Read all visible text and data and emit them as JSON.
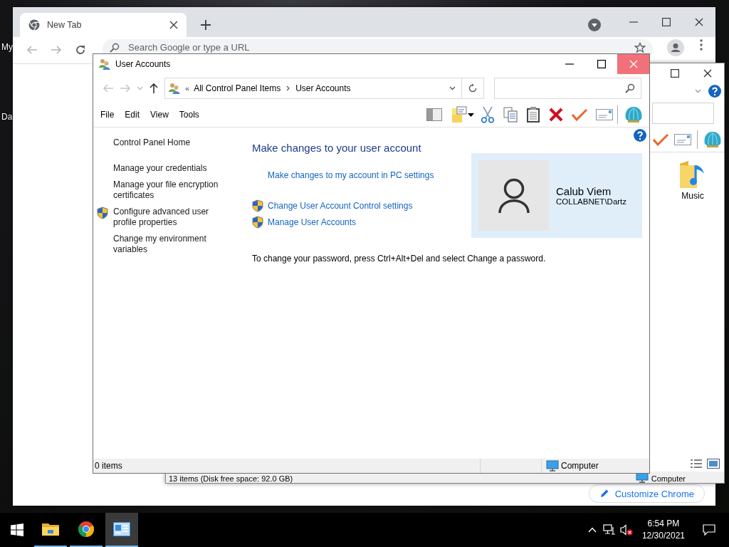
{
  "desktop": {
    "labels": [
      "My",
      "Da"
    ]
  },
  "chrome": {
    "tab": {
      "title": "New Tab",
      "selected": true
    },
    "omnibox": {
      "placeholder": "Search Google or type a URL"
    },
    "customize_button": "Customize Chrome"
  },
  "explorer": {
    "folder": {
      "label": "Music"
    },
    "status_bar": {
      "items": "13 items (Disk free space: 92.0 GB)",
      "location": "Computer"
    }
  },
  "user_accounts": {
    "title": "User Accounts",
    "breadcrumb": {
      "overflow": "«",
      "items": [
        "All Control Panel Items",
        "User Accounts"
      ]
    },
    "menu": [
      "File",
      "Edit",
      "View",
      "Tools"
    ],
    "sidebar": [
      {
        "label": "Control Panel Home",
        "shield": false
      },
      {
        "label": "Manage your credentials",
        "shield": false
      },
      {
        "label": "Manage your file encryption certificates",
        "shield": false
      },
      {
        "label": "Configure advanced user profile properties",
        "shield": true
      },
      {
        "label": "Change my environment variables",
        "shield": false
      }
    ],
    "heading": "Make changes to your user account",
    "links": [
      {
        "label": "Make changes to my account in PC settings",
        "shield": false
      },
      {
        "label": "Change User Account Control settings",
        "shield": true
      },
      {
        "label": "Manage User Accounts",
        "shield": true
      }
    ],
    "account": {
      "name": "Calub Viem",
      "domain": "COLLABNET\\Dartz"
    },
    "note": "To change your password, press Ctrl+Alt+Del and select Change a password.",
    "status_bar": {
      "items": "0 items",
      "location": "Computer"
    }
  },
  "taskbar": {
    "apps": [
      {
        "kind": "explorer",
        "selected": false
      },
      {
        "kind": "chrome",
        "selected": false
      },
      {
        "kind": "control-panel",
        "selected": true
      }
    ],
    "time": "6:54 PM",
    "date": "12/30/2021"
  }
}
